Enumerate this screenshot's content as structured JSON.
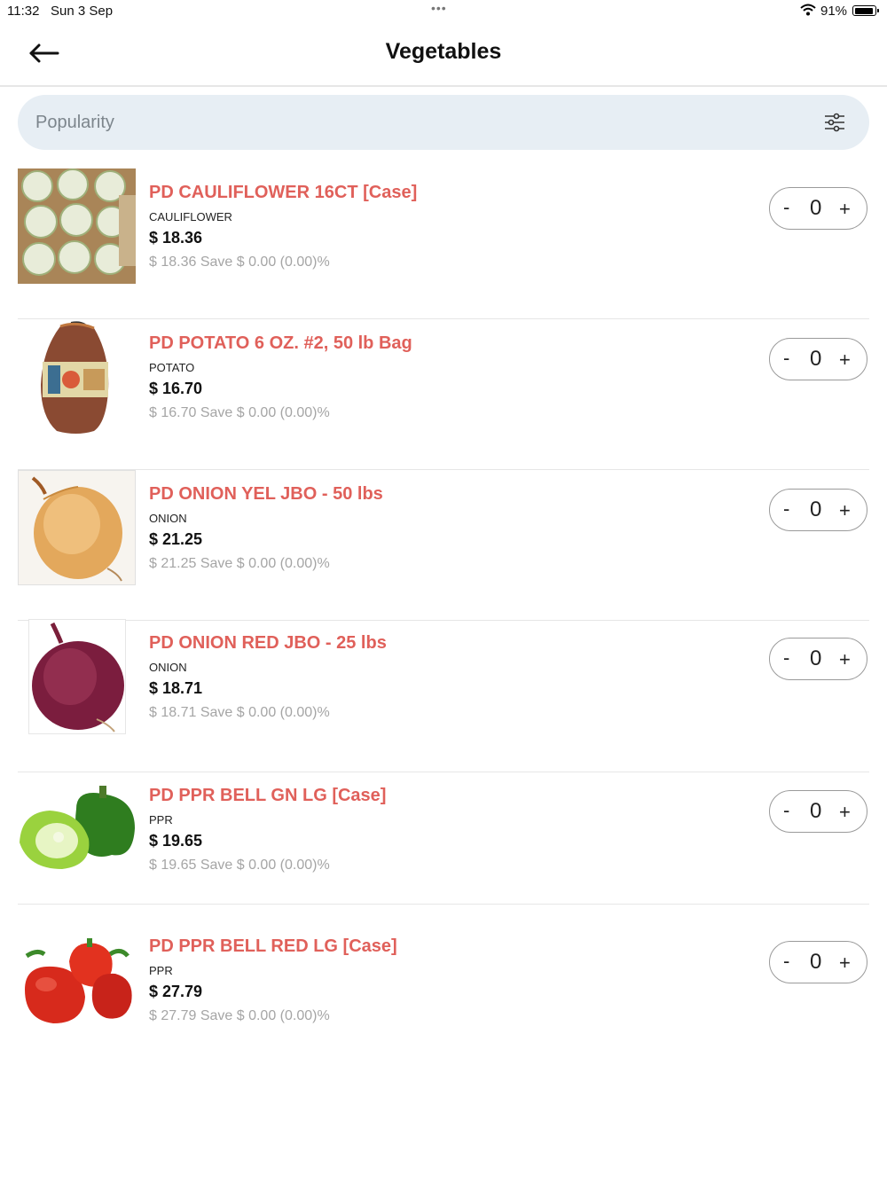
{
  "status_bar": {
    "time": "11:32",
    "date": "Sun 3 Sep",
    "dots": "•••",
    "wifi_icon": "wifi-icon",
    "battery_percent": "91%",
    "battery_level": 0.91
  },
  "header": {
    "title": "Vegetables",
    "back_icon": "arrow-left-icon"
  },
  "sort": {
    "label": "Popularity",
    "icon": "sliders-icon"
  },
  "colors": {
    "accent": "#e0605a",
    "sort_bg": "#e7eef4",
    "muted": "#a5a5a5"
  },
  "products": [
    {
      "name": "PD CAULIFLOWER 16CT [Case]",
      "category": "CAULIFLOWER",
      "price": "$ 18.36",
      "save_text": "$  18.36 Save $ 0.00 (0.00)%",
      "quantity": "0",
      "minus": "-",
      "plus": "+",
      "image": "cauliflower-case"
    },
    {
      "name": "PD POTATO 6 OZ. #2,  50 lb Bag",
      "category": "POTATO",
      "price": "$ 16.70",
      "save_text": "$  16.70 Save $ 0.00 (0.00)%",
      "quantity": "0",
      "minus": "-",
      "plus": "+",
      "image": "potato-bag"
    },
    {
      "name": "PD ONION YEL JBO - 50 lbs",
      "category": "ONION",
      "price": "$ 21.25",
      "save_text": "$  21.25 Save $ 0.00 (0.00)%",
      "quantity": "0",
      "minus": "-",
      "plus": "+",
      "image": "yellow-onion"
    },
    {
      "name": "PD ONION RED JBO - 25 lbs",
      "category": "ONION",
      "price": "$ 18.71",
      "save_text": "$  18.71 Save $ 0.00 (0.00)%",
      "quantity": "0",
      "minus": "-",
      "plus": "+",
      "image": "red-onion"
    },
    {
      "name": "PD PPR BELL GN LG [Case]",
      "category": "PPR",
      "price": "$ 19.65",
      "save_text": "$  19.65 Save $ 0.00 (0.00)%",
      "quantity": "0",
      "minus": "-",
      "plus": "+",
      "image": "green-bell-pepper"
    },
    {
      "name": "PD PPR BELL RED LG [Case]",
      "category": "PPR",
      "price": "$ 27.79",
      "save_text": "$  27.79 Save $ 0.00 (0.00)%",
      "quantity": "0",
      "minus": "-",
      "plus": "+",
      "image": "red-bell-pepper"
    }
  ]
}
